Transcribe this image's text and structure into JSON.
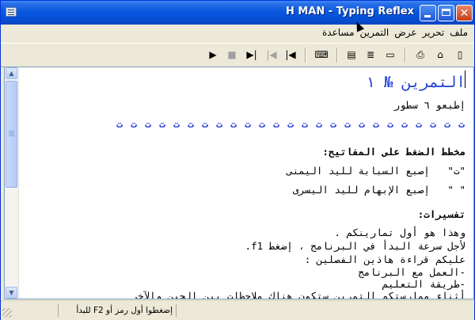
{
  "window": {
    "title": "H MAN - Typing Reflex"
  },
  "menu": {
    "file": "ملف",
    "edit": "تحرير",
    "view": "عرض",
    "exercises": "التمرين",
    "help": "مساعدة"
  },
  "toolbar": {
    "icons": [
      "new-icon",
      "open-icon",
      "print-icon",
      "page-icon",
      "page-lines-icon",
      "page-list-icon",
      "keyboard-icon",
      "skip-back-icon",
      "step-back-icon",
      "step-forward-icon",
      "stop-icon",
      "play-icon"
    ]
  },
  "document": {
    "heading": "التمرين № ١",
    "instruction": "إطبعو ٦ سطور",
    "drill_char": "ت",
    "drill_count": 25,
    "keymap_title": "مخطط الضغط على المفاتيح:",
    "keymap_row1_key": "\"ت\"",
    "keymap_row1_desc": "إصبع السبابة لليد اليمنى",
    "keymap_row2_key": "\" \"",
    "keymap_row2_desc": "إصبع الإبهام لليد اليسرى",
    "explanations_title": "تفسيرات:",
    "lines": [
      "وهذا هو أول تمارينكم .",
      "لأجل سرعة البدأ في البرنامج ، إضغط f1.",
      "عليكم قراءة هاذين الفصلين :",
      "-العمل مع البرنامج",
      "-طريقة التعليم",
      "أثناء ممارستكم التمرين ستكون هناك ملاحظات بين الحين والآخر"
    ]
  },
  "status": {
    "hint": "إضغطوا أول رمز أو F2 للبدأ"
  }
}
